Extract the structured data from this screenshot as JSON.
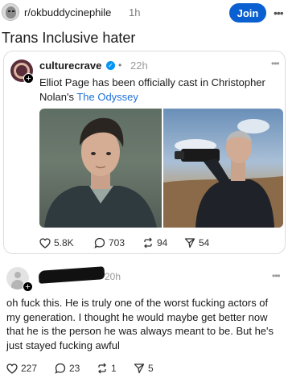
{
  "header": {
    "subreddit": "r/okbuddycinephile",
    "time": "1h",
    "join_label": "Join",
    "more_label": "•••"
  },
  "post": {
    "title": "Trans Inclusive hater"
  },
  "embedded_post": {
    "username": "culturecrave",
    "verified_icon": "verified-badge-icon",
    "separator": "•",
    "time": "22h",
    "more_label": "•••",
    "text_prefix": "Elliot Page has been officially cast in Christopher Nolan's ",
    "text_link": "The Odyssey",
    "images": [
      "elliot-page-photo",
      "christopher-nolan-photo"
    ],
    "stats": {
      "likes": "5.8K",
      "replies": "703",
      "reposts": "94",
      "shares": "54"
    }
  },
  "comment": {
    "time": "20h",
    "more_label": "•••",
    "text": "oh fuck this. He is truly one of the worst fucking actors of my generation.  I thought he would maybe get better now that he is the person he was always meant to be. But he's just stayed fucking awful",
    "stats": {
      "likes": "227",
      "replies": "23",
      "reposts": "1",
      "shares": "5"
    }
  },
  "colors": {
    "join_button": "#0a5fd1",
    "link": "#1e6fd9",
    "verified": "#0095f6"
  }
}
